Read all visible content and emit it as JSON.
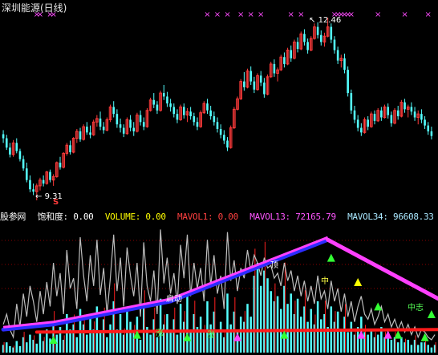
{
  "window": {
    "title": "深圳能源(日线)"
  },
  "price_panel": {
    "high_label": "12.46",
    "low_label": "9.31",
    "s_marker": "S",
    "colors": {
      "up": "#ff3b3b",
      "down": "#54ffff",
      "xmark": "#ff4cff",
      "label": "#ffffff"
    }
  },
  "indicator_panel": {
    "name": "股参网",
    "items": [
      {
        "label": "饱和度:",
        "value": "0.00",
        "color": "#ffffff"
      },
      {
        "label": "VOLUME:",
        "value": "0.00",
        "color": "#ffff00"
      },
      {
        "label": "MAVOL1:",
        "value": "0.00",
        "color": "#ff4040"
      },
      {
        "label": "MAVOL13:",
        "value": "72165.79",
        "color": "#ff55ff"
      },
      {
        "label": "MAVOL34:",
        "value": "96608.33",
        "color": "#aae8ff"
      },
      {
        "label": "MA",
        "value": "",
        "color": "#ff2020"
      }
    ],
    "signal_labels": [
      {
        "text": "启动",
        "color": "#ffffff"
      },
      {
        "text": "涨",
        "color": "#55ff55"
      },
      {
        "text": "涨",
        "color": "#55ff55"
      },
      {
        "text": "顶",
        "color": "#ffffff"
      },
      {
        "text": "中",
        "color": "#ffff44"
      },
      {
        "text": "中志",
        "color": "#55ff55"
      }
    ],
    "colors": {
      "gray_line": "#bdbdbd",
      "blue_trend": "#2c2cff",
      "magenta_trend": "#ff40ff",
      "red_trend": "#ff1a1a",
      "red_bar": "#ff2020",
      "cyan_bar": "#55ffff",
      "green_tri": "#33ff33",
      "yellow_tri": "#ffff00",
      "magenta_tri": "#ff40ff"
    }
  },
  "chart_data": [
    {
      "type": "candlestick",
      "title": "深圳能源(日线)",
      "x_marks": [
        10,
        11,
        14,
        15,
        61,
        64,
        67,
        71,
        74,
        77,
        86,
        89,
        99,
        100,
        101,
        102,
        103,
        104,
        112,
        120,
        127
      ],
      "annotations": [
        {
          "index": 97,
          "text": "12.46",
          "kind": "max"
        },
        {
          "index": 10,
          "text": "9.31",
          "kind": "min"
        }
      ],
      "ohlc": [
        [
          10.45,
          10.52,
          10.3,
          10.38
        ],
        [
          10.38,
          10.44,
          10.18,
          10.22
        ],
        [
          10.22,
          10.3,
          10.05,
          10.1
        ],
        [
          10.1,
          10.35,
          10.06,
          10.3
        ],
        [
          10.3,
          10.38,
          10.12,
          10.16
        ],
        [
          10.16,
          10.2,
          9.98,
          10.02
        ],
        [
          10.02,
          10.08,
          9.82,
          9.86
        ],
        [
          9.86,
          9.96,
          9.62,
          9.66
        ],
        [
          9.66,
          9.74,
          9.45,
          9.5
        ],
        [
          9.5,
          9.6,
          9.4,
          9.46
        ],
        [
          9.46,
          9.6,
          9.31,
          9.56
        ],
        [
          9.56,
          9.7,
          9.48,
          9.66
        ],
        [
          9.66,
          9.74,
          9.55,
          9.6
        ],
        [
          9.6,
          9.82,
          9.58,
          9.8
        ],
        [
          9.8,
          9.84,
          9.62,
          9.66
        ],
        [
          9.66,
          9.76,
          9.56,
          9.72
        ],
        [
          9.72,
          9.98,
          9.7,
          9.96
        ],
        [
          9.96,
          10.06,
          9.84,
          9.88
        ],
        [
          9.88,
          10.14,
          9.86,
          10.12
        ],
        [
          10.12,
          10.3,
          10.08,
          10.26
        ],
        [
          10.26,
          10.34,
          10.1,
          10.14
        ],
        [
          10.14,
          10.4,
          10.12,
          10.38
        ],
        [
          10.38,
          10.54,
          10.3,
          10.5
        ],
        [
          10.5,
          10.56,
          10.32,
          10.36
        ],
        [
          10.36,
          10.62,
          10.34,
          10.58
        ],
        [
          10.58,
          10.66,
          10.44,
          10.48
        ],
        [
          10.48,
          10.6,
          10.38,
          10.44
        ],
        [
          10.44,
          10.7,
          10.42,
          10.66
        ],
        [
          10.66,
          10.78,
          10.58,
          10.72
        ],
        [
          10.72,
          10.84,
          10.52,
          10.58
        ],
        [
          10.58,
          10.66,
          10.46,
          10.52
        ],
        [
          10.52,
          10.74,
          10.5,
          10.7
        ],
        [
          10.7,
          10.96,
          10.66,
          10.92
        ],
        [
          10.92,
          11.02,
          10.74,
          10.8
        ],
        [
          10.8,
          10.88,
          10.56,
          10.62
        ],
        [
          10.62,
          10.72,
          10.48,
          10.56
        ],
        [
          10.56,
          10.62,
          10.4,
          10.46
        ],
        [
          10.46,
          10.74,
          10.44,
          10.7
        ],
        [
          10.7,
          10.78,
          10.5,
          10.56
        ],
        [
          10.56,
          10.66,
          10.42,
          10.5
        ],
        [
          10.5,
          10.82,
          10.48,
          10.78
        ],
        [
          10.78,
          10.86,
          10.6,
          10.66
        ],
        [
          10.66,
          10.74,
          10.52,
          10.58
        ],
        [
          10.58,
          10.9,
          10.56,
          10.86
        ],
        [
          10.86,
          11.08,
          10.84,
          11.04
        ],
        [
          11.04,
          11.16,
          10.9,
          10.96
        ],
        [
          10.96,
          11.02,
          10.8,
          10.86
        ],
        [
          10.86,
          11.2,
          10.84,
          11.16
        ],
        [
          11.16,
          11.3,
          11.04,
          11.1
        ],
        [
          11.1,
          11.18,
          10.92,
          10.98
        ],
        [
          10.98,
          11.06,
          10.84,
          10.92
        ],
        [
          10.92,
          10.98,
          10.74,
          10.8
        ],
        [
          10.8,
          10.88,
          10.64,
          10.7
        ],
        [
          10.7,
          10.96,
          10.68,
          10.92
        ],
        [
          10.92,
          10.98,
          10.72,
          10.78
        ],
        [
          10.78,
          10.9,
          10.66,
          10.84
        ],
        [
          10.84,
          10.92,
          10.7,
          10.76
        ],
        [
          10.76,
          10.82,
          10.6,
          10.66
        ],
        [
          10.66,
          10.74,
          10.52,
          10.58
        ],
        [
          10.58,
          10.86,
          10.56,
          10.82
        ],
        [
          10.82,
          11.02,
          10.8,
          10.98
        ],
        [
          10.98,
          11.06,
          10.8,
          10.86
        ],
        [
          10.86,
          10.94,
          10.7,
          10.76
        ],
        [
          10.76,
          10.84,
          10.6,
          10.66
        ],
        [
          10.66,
          10.74,
          10.48,
          10.54
        ],
        [
          10.54,
          10.62,
          10.38,
          10.44
        ],
        [
          10.44,
          10.52,
          10.28,
          10.34
        ],
        [
          10.34,
          10.4,
          10.16,
          10.22
        ],
        [
          10.22,
          10.6,
          10.2,
          10.56
        ],
        [
          10.56,
          10.92,
          10.54,
          10.88
        ],
        [
          10.88,
          11.1,
          10.86,
          11.06
        ],
        [
          11.06,
          11.4,
          11.04,
          11.36
        ],
        [
          11.36,
          11.52,
          11.2,
          11.26
        ],
        [
          11.26,
          11.58,
          11.24,
          11.54
        ],
        [
          11.54,
          11.62,
          11.3,
          11.36
        ],
        [
          11.36,
          11.44,
          11.16,
          11.22
        ],
        [
          11.22,
          11.5,
          11.2,
          11.46
        ],
        [
          11.46,
          11.54,
          11.28,
          11.34
        ],
        [
          11.34,
          11.42,
          11.08,
          11.14
        ],
        [
          11.14,
          11.48,
          11.12,
          11.44
        ],
        [
          11.44,
          11.7,
          11.42,
          11.66
        ],
        [
          11.66,
          11.74,
          11.44,
          11.5
        ],
        [
          11.5,
          11.6,
          11.36,
          11.56
        ],
        [
          11.56,
          11.82,
          11.54,
          11.78
        ],
        [
          11.78,
          11.86,
          11.6,
          11.66
        ],
        [
          11.66,
          11.94,
          11.64,
          11.9
        ],
        [
          11.9,
          11.98,
          11.7,
          11.76
        ],
        [
          11.76,
          12.08,
          11.74,
          12.04
        ],
        [
          12.04,
          12.12,
          11.86,
          11.92
        ],
        [
          11.92,
          12.22,
          11.9,
          12.18
        ],
        [
          12.18,
          12.26,
          11.98,
          12.04
        ],
        [
          12.04,
          12.1,
          11.84,
          11.9
        ],
        [
          11.9,
          12.14,
          11.88,
          12.1
        ],
        [
          12.1,
          12.36,
          12.08,
          12.3
        ],
        [
          12.3,
          12.38,
          12.1,
          12.16
        ],
        [
          12.16,
          12.24,
          11.98,
          12.04
        ],
        [
          12.04,
          12.2,
          11.96,
          12.14
        ],
        [
          12.14,
          12.46,
          12.12,
          12.3
        ],
        [
          12.3,
          12.36,
          12.02,
          12.08
        ],
        [
          12.08,
          12.14,
          11.84,
          11.9
        ],
        [
          11.9,
          11.96,
          11.66,
          11.72
        ],
        [
          11.72,
          11.82,
          11.6,
          11.76
        ],
        [
          11.76,
          11.84,
          11.5,
          11.56
        ],
        [
          11.56,
          11.62,
          11.1,
          11.16
        ],
        [
          11.16,
          11.22,
          10.8,
          10.86
        ],
        [
          10.86,
          10.94,
          10.64,
          10.7
        ],
        [
          10.7,
          10.78,
          10.5,
          10.56
        ],
        [
          10.56,
          10.64,
          10.42,
          10.48
        ],
        [
          10.48,
          10.74,
          10.46,
          10.7
        ],
        [
          10.7,
          10.76,
          10.52,
          10.58
        ],
        [
          10.58,
          10.84,
          10.56,
          10.8
        ],
        [
          10.8,
          10.86,
          10.62,
          10.68
        ],
        [
          10.68,
          10.9,
          10.66,
          10.86
        ],
        [
          10.86,
          10.92,
          10.68,
          10.74
        ],
        [
          10.74,
          10.96,
          10.72,
          10.92
        ],
        [
          10.92,
          10.98,
          10.72,
          10.78
        ],
        [
          10.78,
          10.84,
          10.58,
          10.64
        ],
        [
          10.64,
          10.9,
          10.62,
          10.86
        ],
        [
          10.86,
          10.94,
          10.7,
          10.76
        ],
        [
          10.76,
          11.04,
          10.74,
          11.0
        ],
        [
          11.0,
          11.06,
          10.82,
          10.88
        ],
        [
          10.88,
          10.96,
          10.74,
          10.92
        ],
        [
          10.92,
          11.0,
          10.78,
          10.84
        ],
        [
          10.84,
          10.92,
          10.68,
          10.74
        ],
        [
          10.74,
          10.86,
          10.62,
          10.8
        ],
        [
          10.8,
          10.88,
          10.64,
          10.7
        ],
        [
          10.7,
          10.76,
          10.54,
          10.6
        ],
        [
          10.6,
          10.66,
          10.44,
          10.5
        ],
        [
          10.5,
          10.58,
          10.36,
          10.42
        ]
      ]
    },
    {
      "type": "line",
      "title": "股参网 饱和度",
      "ylim": [
        0,
        100
      ],
      "series": [
        {
          "key": "saturation",
          "values": [
            22,
            30,
            18,
            12,
            38,
            20,
            46,
            28,
            52,
            40,
            24,
            48,
            30,
            55,
            36,
            70,
            44,
            62,
            30,
            80,
            50,
            58,
            34,
            90,
            60,
            40,
            76,
            52,
            88,
            45,
            66,
            30,
            58,
            92,
            48,
            74,
            36,
            82,
            60,
            44,
            70,
            28,
            86,
            52,
            40,
            64,
            30,
            96,
            54,
            74,
            46,
            62,
            38,
            84,
            58,
            92,
            44,
            70,
            50,
            66,
            40,
            88,
            52,
            76,
            46,
            60,
            34,
            94,
            56,
            72,
            48,
            66,
            58,
            80,
            64,
            76,
            70,
            60,
            74,
            66,
            68,
            58,
            62,
            52,
            70,
            56,
            64,
            48,
            60,
            44,
            56,
            40,
            52,
            38,
            60,
            42,
            48,
            34,
            56,
            40,
            50,
            32,
            46,
            28,
            40,
            24,
            36,
            44,
            30,
            26,
            34,
            22,
            28,
            36,
            24,
            30,
            20,
            26,
            18,
            24,
            16,
            22,
            14,
            20,
            12,
            18,
            16,
            12,
            10,
            14
          ]
        },
        {
          "key": "volume",
          "values": [
            6,
            8,
            5,
            4,
            9,
            5,
            12,
            8,
            14,
            10,
            7,
            16,
            9,
            18,
            11,
            24,
            14,
            20,
            10,
            30,
            18,
            22,
            12,
            34,
            22,
            14,
            28,
            18,
            36,
            16,
            26,
            12,
            22,
            40,
            18,
            30,
            14,
            34,
            24,
            16,
            28,
            10,
            36,
            20,
            14,
            26,
            12,
            42,
            22,
            30,
            18,
            26,
            14,
            38,
            24,
            44,
            18,
            30,
            20,
            28,
            16,
            40,
            22,
            32,
            18,
            24,
            12,
            46,
            22,
            32,
            18,
            28,
            24,
            38,
            28,
            60,
            70,
            52,
            64,
            58,
            48,
            40,
            44,
            34,
            52,
            38,
            46,
            30,
            42,
            28,
            36,
            24,
            34,
            22,
            40,
            26,
            30,
            20,
            36,
            24,
            32,
            18,
            28,
            16,
            24,
            14,
            20,
            28,
            16,
            14,
            18,
            12,
            14,
            20,
            12,
            16,
            10,
            12,
            8,
            12,
            8,
            10,
            6,
            10,
            6,
            8,
            8,
            6,
            4,
            6
          ]
        },
        {
          "key": "trend_blue",
          "values": [
            [
              0,
              18
            ],
            [
              15,
              22
            ],
            [
              50,
              40
            ],
            [
              97,
              88
            ]
          ]
        },
        {
          "key": "trend_magenta",
          "values": [
            [
              97,
              88
            ],
            [
              130,
              42
            ]
          ]
        },
        {
          "key": "trend_red",
          "values": [
            [
              10,
              16
            ],
            [
              130,
              18
            ]
          ]
        }
      ]
    }
  ]
}
